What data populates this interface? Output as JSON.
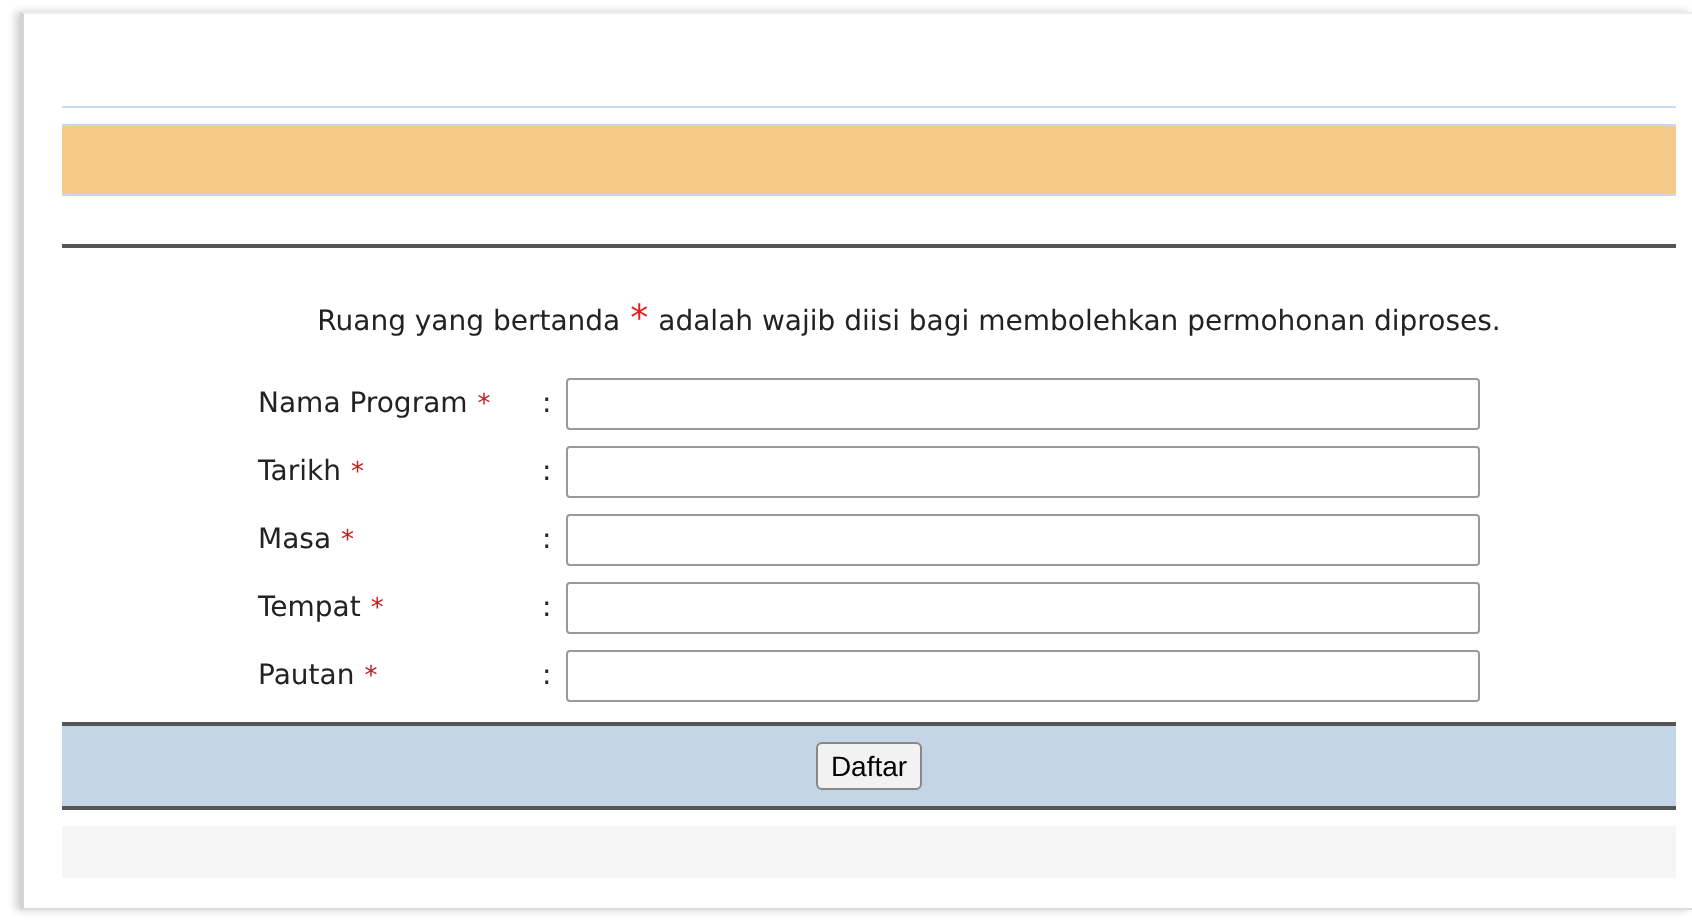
{
  "notice": {
    "before": "Ruang yang bertanda",
    "mark": "*",
    "after": "adalah wajib diisi bagi membolehkan permohonan diproses."
  },
  "separator": ":",
  "fields": [
    {
      "label": "Nama Program",
      "required": true
    },
    {
      "label": "Tarikh",
      "required": true
    },
    {
      "label": "Masa",
      "required": true
    },
    {
      "label": "Tempat",
      "required": true
    },
    {
      "label": "Pautan",
      "required": true
    }
  ],
  "submit_button": "Daftar"
}
